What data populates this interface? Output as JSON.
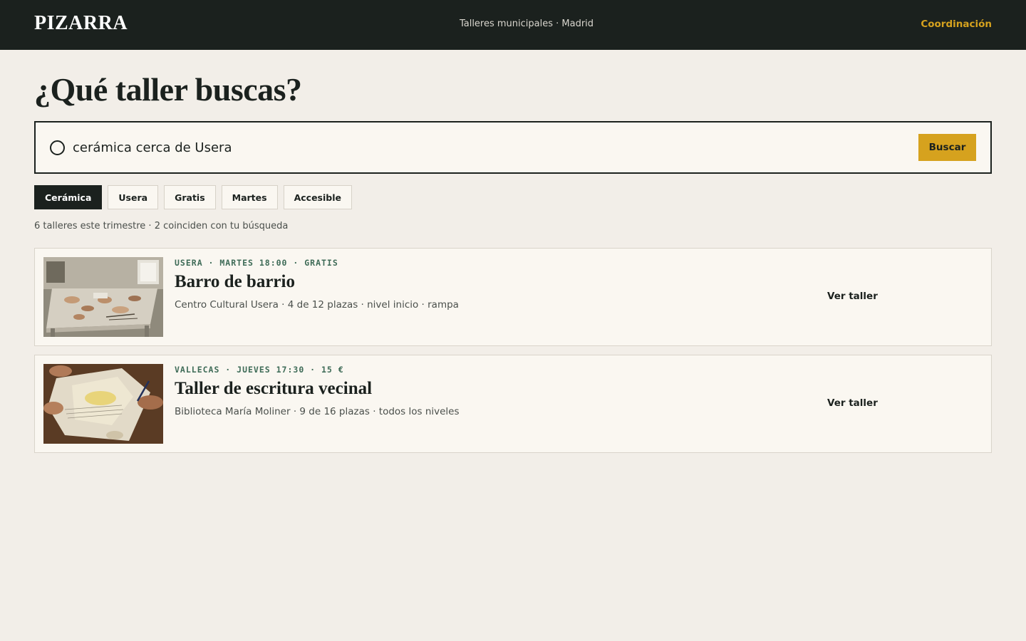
{
  "header": {
    "brand": "PIZARRA",
    "tagline": "Talleres municipales · Madrid",
    "nav_link": "Coordinación"
  },
  "main": {
    "title": "¿Qué taller buscas?",
    "search": {
      "value": "cerámica cerca de Usera",
      "button_label": "Buscar",
      "icon": "search-icon"
    },
    "filters": [
      {
        "label": "Cerámica",
        "active": true
      },
      {
        "label": "Usera",
        "active": false
      },
      {
        "label": "Gratis",
        "active": false
      },
      {
        "label": "Martes",
        "active": false
      },
      {
        "label": "Accesible",
        "active": false
      }
    ],
    "summary": "6 talleres este trimestre · 2 coinciden con tu búsqueda",
    "results": [
      {
        "kicker": "USERA · MARTES 18:00 · GRATIS",
        "title": "Barro de barrio",
        "meta": "Centro Cultural Usera · 4 de 12 plazas · nivel inicio · rampa",
        "link": "Ver taller"
      },
      {
        "kicker": "VALLECAS · JUEVES 17:30 · 15 €",
        "title": "Taller de escritura vecinal",
        "meta": "Biblioteca María Moliner · 9 de 16 plazas · todos los niveles",
        "link": "Ver taller"
      }
    ]
  },
  "colors": {
    "background": "#f2eee8",
    "header": "#1b211e",
    "accent": "#d6a21e",
    "kicker": "#3e6b57"
  }
}
